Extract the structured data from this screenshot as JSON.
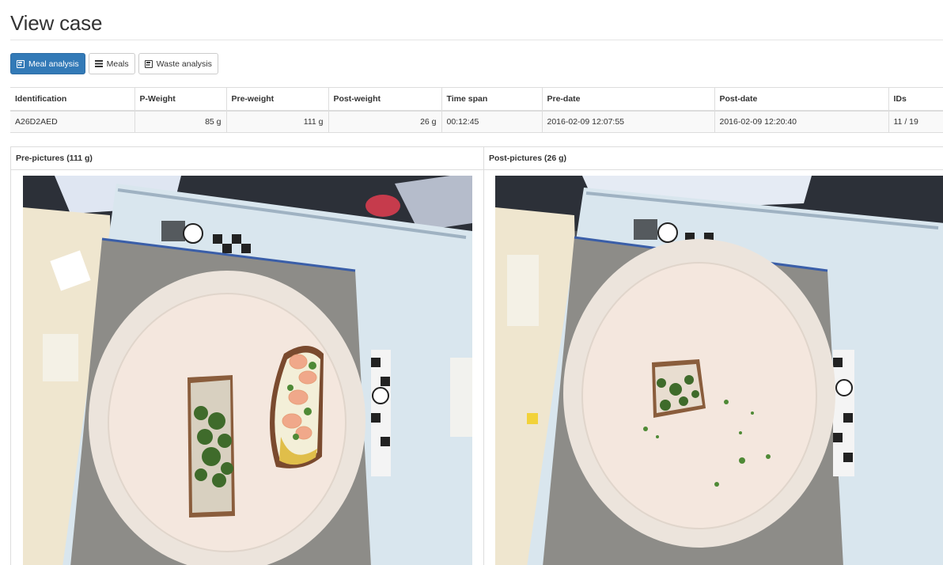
{
  "page": {
    "title": "View case"
  },
  "tabs": [
    {
      "label": "Meal analysis",
      "icon": "calculator-icon",
      "active": true
    },
    {
      "label": "Meals",
      "icon": "list-icon",
      "active": false
    },
    {
      "label": "Waste analysis",
      "icon": "calculator-icon",
      "active": false
    }
  ],
  "table": {
    "headers": [
      "Identification",
      "P-Weight",
      "Pre-weight",
      "Post-weight",
      "Time span",
      "Pre-date",
      "Post-date",
      "IDs"
    ],
    "row": [
      "A26D2AED",
      "85 g",
      "111 g",
      "26 g",
      "00:12:45",
      "2016-02-09 12:07:55",
      "2016-02-09 12:20:40",
      "11 / 19"
    ]
  },
  "panels": {
    "pre_title": "Pre-pictures (111 g)",
    "post_title": "Post-pictures (26 g)"
  },
  "colors": {
    "primary": "#337ab7",
    "border": "#dddddd",
    "row_bg": "#f9f9f9"
  }
}
